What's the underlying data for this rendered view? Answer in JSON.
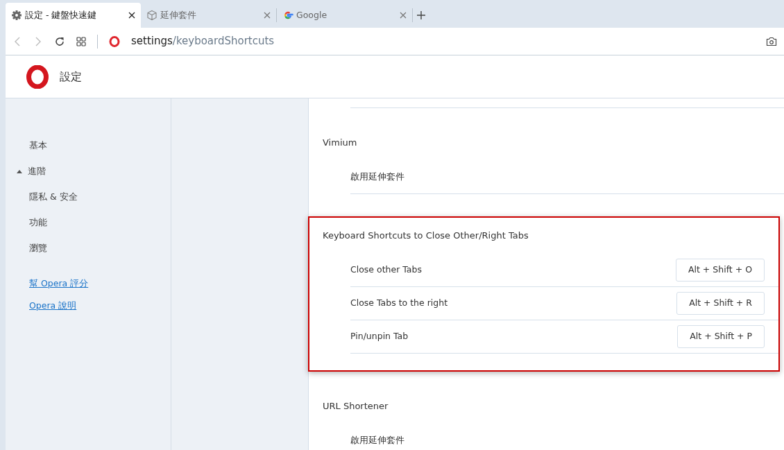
{
  "tabs": [
    {
      "title": "設定 - 鍵盤快速鍵",
      "kind": "settings",
      "selected": true
    },
    {
      "title": "延伸套件",
      "kind": "extensions",
      "selected": false
    },
    {
      "title": "Google",
      "kind": "web",
      "selected": false
    }
  ],
  "address_bar": {
    "host": "settings",
    "path": "/keyboardShortcuts"
  },
  "header": {
    "title": "設定"
  },
  "sidebar": {
    "items": [
      {
        "label": "基本",
        "kind": "item"
      },
      {
        "label": "進階",
        "kind": "group",
        "expanded": true
      },
      {
        "label": "隱私 & 安全",
        "kind": "item"
      },
      {
        "label": "功能",
        "kind": "item"
      },
      {
        "label": "瀏覽",
        "kind": "item"
      }
    ],
    "links": [
      "幫 Opera 評分",
      "Opera 說明"
    ]
  },
  "sections": [
    {
      "title": "Vimium",
      "highlighted": false,
      "rows": [
        {
          "kind": "text",
          "label": "啟用延伸套件"
        }
      ]
    },
    {
      "title": "Keyboard Shortcuts to Close Other/Right Tabs",
      "highlighted": true,
      "rows": [
        {
          "kind": "shortcut",
          "label": "Close other Tabs",
          "shortcut": "Alt + Shift + O"
        },
        {
          "kind": "shortcut",
          "label": "Close Tabs to the right",
          "shortcut": "Alt + Shift + R"
        },
        {
          "kind": "shortcut",
          "label": "Pin/unpin Tab",
          "shortcut": "Alt + Shift + P"
        }
      ]
    },
    {
      "title": "URL Shortener",
      "highlighted": false,
      "rows": [
        {
          "kind": "text",
          "label": "啟用延伸套件"
        }
      ]
    }
  ]
}
